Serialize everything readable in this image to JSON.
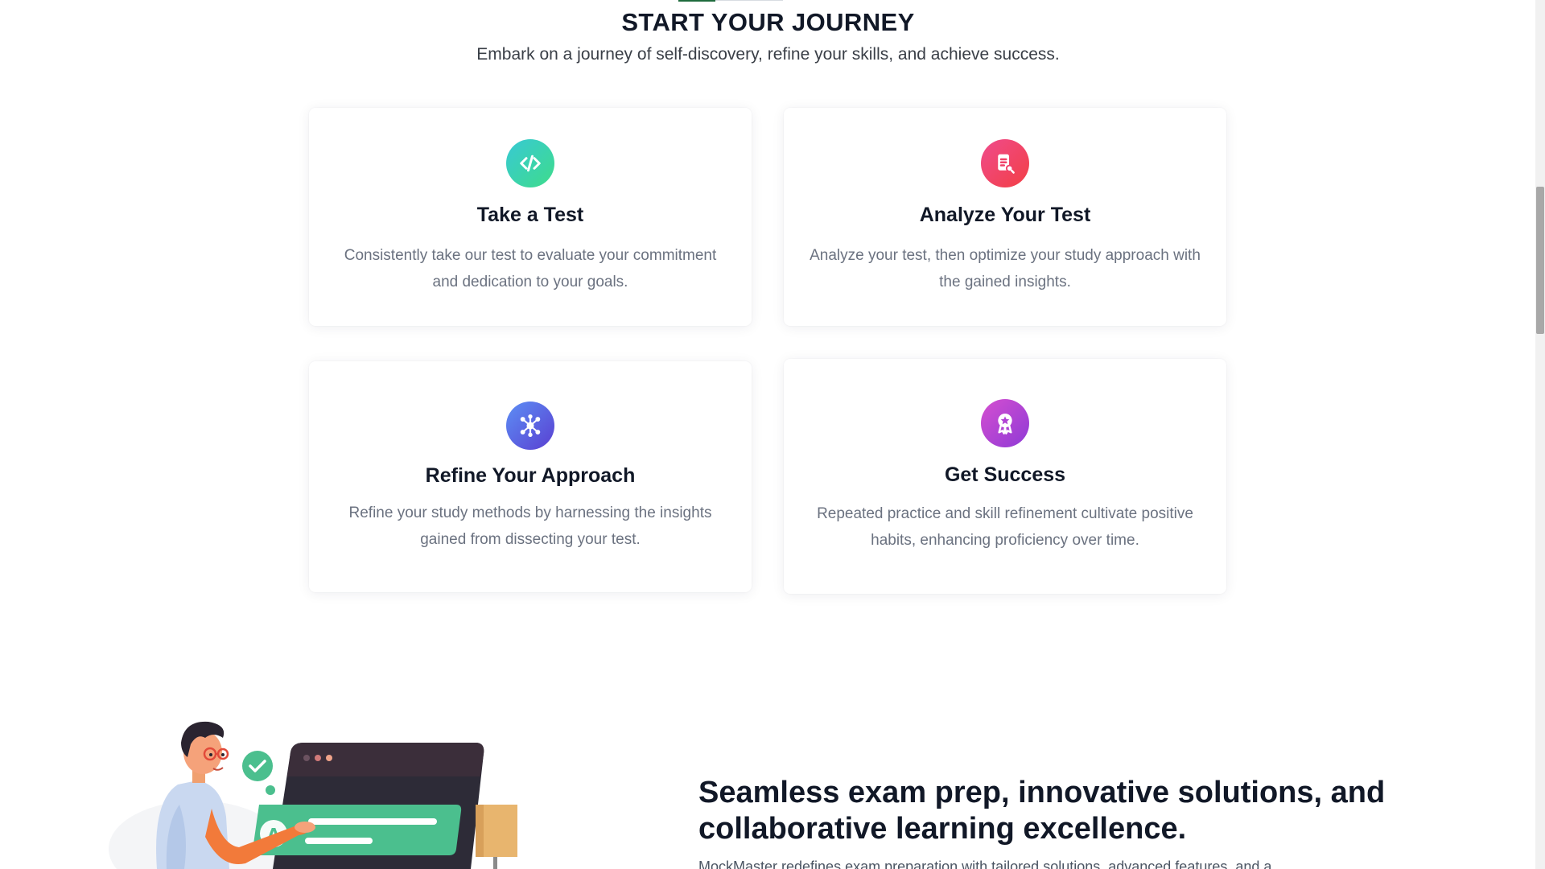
{
  "journey": {
    "title": "START YOUR JOURNEY",
    "subtitle": "Embark on a journey of self-discovery, refine your skills, and achieve success."
  },
  "cards": [
    {
      "icon": "code-icon",
      "title": "Take a Test",
      "description": "Consistently take our test to evaluate your commitment and dedication to your goals."
    },
    {
      "icon": "document-search-icon",
      "title": "Analyze Your Test",
      "description": "Analyze your test, then optimize your study approach with the gained insights."
    },
    {
      "icon": "network-icon",
      "title": "Refine Your Approach",
      "description": "Refine your study methods by harnessing the insights gained from dissecting your test."
    },
    {
      "icon": "award-badge-icon",
      "title": "Get Success",
      "description": "Repeated practice and skill refinement cultivate positive habits, enhancing proficiency over time."
    }
  ],
  "feature": {
    "heading": "Seamless exam prep, innovative solutions, and collaborative learning excellence.",
    "text": "MockMaster redefines exam preparation with tailored solutions, advanced features, and a"
  },
  "colors": {
    "accent_green": "#1e6b3c",
    "icon_green": "#3edc8b",
    "icon_red": "#f23f45",
    "icon_blue": "#5a3fd1",
    "icon_purple": "#8f3ad6"
  }
}
